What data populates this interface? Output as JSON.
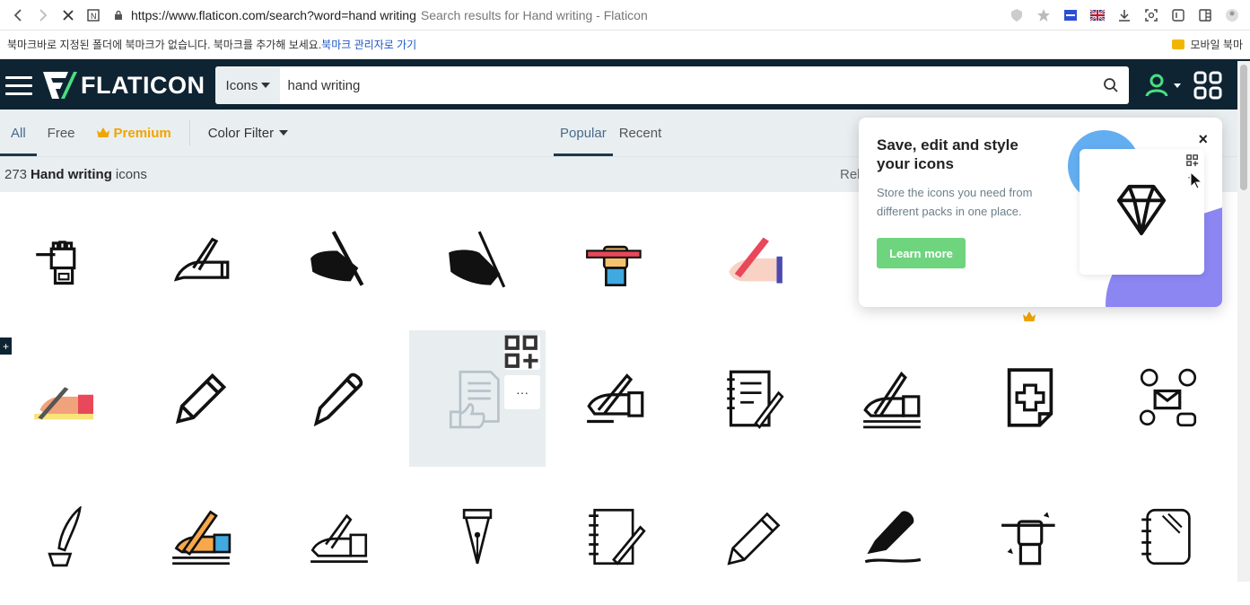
{
  "browser": {
    "url": "https://www.flaticon.com/search?word=hand writing",
    "page_title": "Search results for Hand writing - Flaticon",
    "bookmarks_message": "북마크바로 지정된 폴더에 북마크가 없습니다. 북마크를 추가해 보세요.",
    "bookmarks_link": "북마크 관리자로 가기",
    "mobile_bookmarks": "모바일 북마"
  },
  "header": {
    "logo": "FLATICON",
    "search_type": "Icons",
    "search_value": "hand writing"
  },
  "filters": {
    "tabs": [
      "All",
      "Free",
      "Premium"
    ],
    "color_filter": "Color Filter",
    "sort": [
      "Popular",
      "Recent"
    ]
  },
  "results": {
    "count": "273",
    "query": "Hand writing",
    "suffix": "icons",
    "related_label": "Rel"
  },
  "popup": {
    "title": "Save, edit and style your icons",
    "description": "Store the icons you need from different packs in one place.",
    "button": "Learn more",
    "close": "×"
  },
  "hover_actions": [
    "add-to-collection",
    "more"
  ],
  "colors": {
    "header_bg": "#0e2433",
    "filters_bg": "#e9eef1",
    "brand_green": "#4ade80",
    "premium": "#f0a500",
    "learn_more": "#6fd47e"
  }
}
